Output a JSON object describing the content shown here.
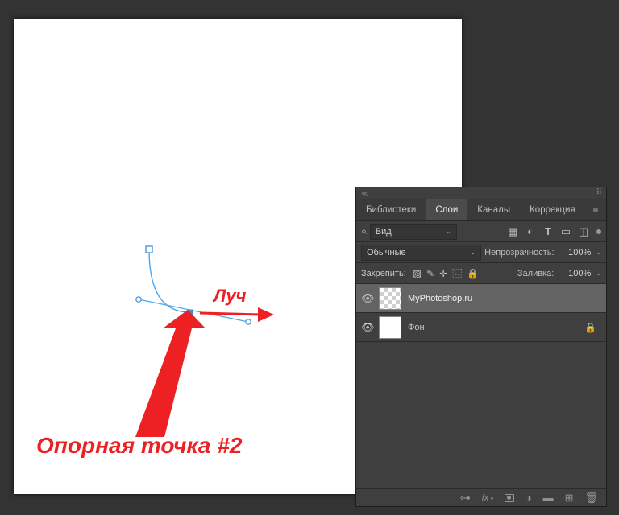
{
  "annotations": {
    "ray": "Луч",
    "anchor": "Опорная точка #2"
  },
  "panel": {
    "tabs": {
      "libraries": "Библиотеки",
      "layers": "Слои",
      "channels": "Каналы",
      "adjustments": "Коррекция"
    },
    "row1": {
      "kind": "Вид"
    },
    "row2": {
      "blend": "Обычные",
      "opacity_label": "Непрозрачность:",
      "opacity_value": "100%"
    },
    "row3": {
      "lock_label": "Закрепить:",
      "fill_label": "Заливка:",
      "fill_value": "100%"
    },
    "layers": [
      {
        "name": "MyPhotoshop.ru",
        "selected": true,
        "transparent": true,
        "locked": false
      },
      {
        "name": "Фон",
        "selected": false,
        "transparent": false,
        "locked": true
      }
    ]
  },
  "colors": {
    "accent_red": "#ed2024",
    "panel_bg": "#3f3f3f"
  }
}
